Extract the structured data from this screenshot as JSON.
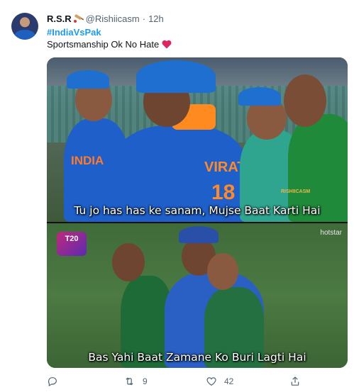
{
  "tweet": {
    "author_name": "R.S.R",
    "author_handle": "@Rishiicasm",
    "separator": "·",
    "time": "12h",
    "hashtag": "#IndiaVsPak",
    "text": "Sportsmanship Ok No Hate",
    "emoji_icon": "red-heart-icon"
  },
  "media": {
    "top_panel": {
      "caption": "Tu jo has has ke sanam, Mujse Baat Karti Hai",
      "jersey_text_1": "INDIA",
      "jersey_text_2": "VIRAT",
      "jersey_number": "18",
      "watermark": "RISHIICASM"
    },
    "bottom_panel": {
      "caption": "Bas Yahi Baat Zamane Ko Buri Lagti Hai",
      "logo": "T20",
      "broadcaster": "hotstar"
    }
  },
  "actions": {
    "reply_count": "",
    "retweet_count": "9",
    "like_count": "42"
  },
  "colors": {
    "link_blue": "#1d9bf0",
    "muted": "#536471",
    "heart": "#f91880"
  }
}
